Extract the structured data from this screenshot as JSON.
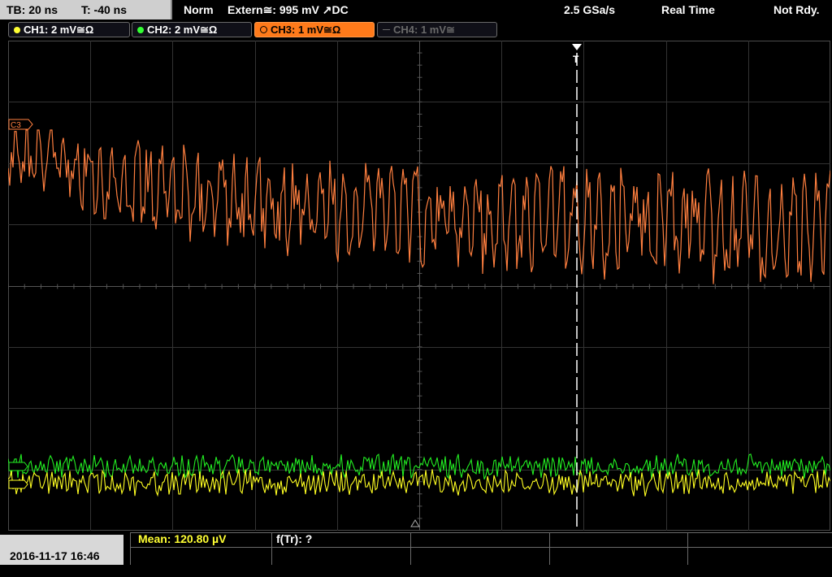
{
  "topbar": {
    "timebase": "TB: 20 ns",
    "trigger_time": "T: -40 ns",
    "trigger_mode": "Norm",
    "trigger_source": "Extern≅: 995 mV ↗DC",
    "sample_rate": "2.5 GSa/s",
    "acq_mode": "Real Time",
    "status": "Not Rdy."
  },
  "channels": [
    {
      "label": "CH1: 2 mV≅Ω",
      "color": "#ffff33",
      "active": true
    },
    {
      "label": "CH2: 2 mV≅Ω",
      "color": "#33ff33",
      "active": true
    },
    {
      "label": "CH3: 1 mV≅Ω",
      "color": "#ff7a1a",
      "active": true
    },
    {
      "label": "CH4: 1 mV≅",
      "color": "#6a6a6a",
      "active": false
    }
  ],
  "waveform": {
    "ch3_marker": "C3",
    "trigger_marker": "T",
    "ch3_color": "#ff7f3f",
    "ch2_color": "#22ee22",
    "ch1_color": "#ffff22"
  },
  "measurements": {
    "mean": "Mean: 120.80 µV",
    "freq": "f(Tr): ?"
  },
  "datetime": "2016-11-17 16:46"
}
